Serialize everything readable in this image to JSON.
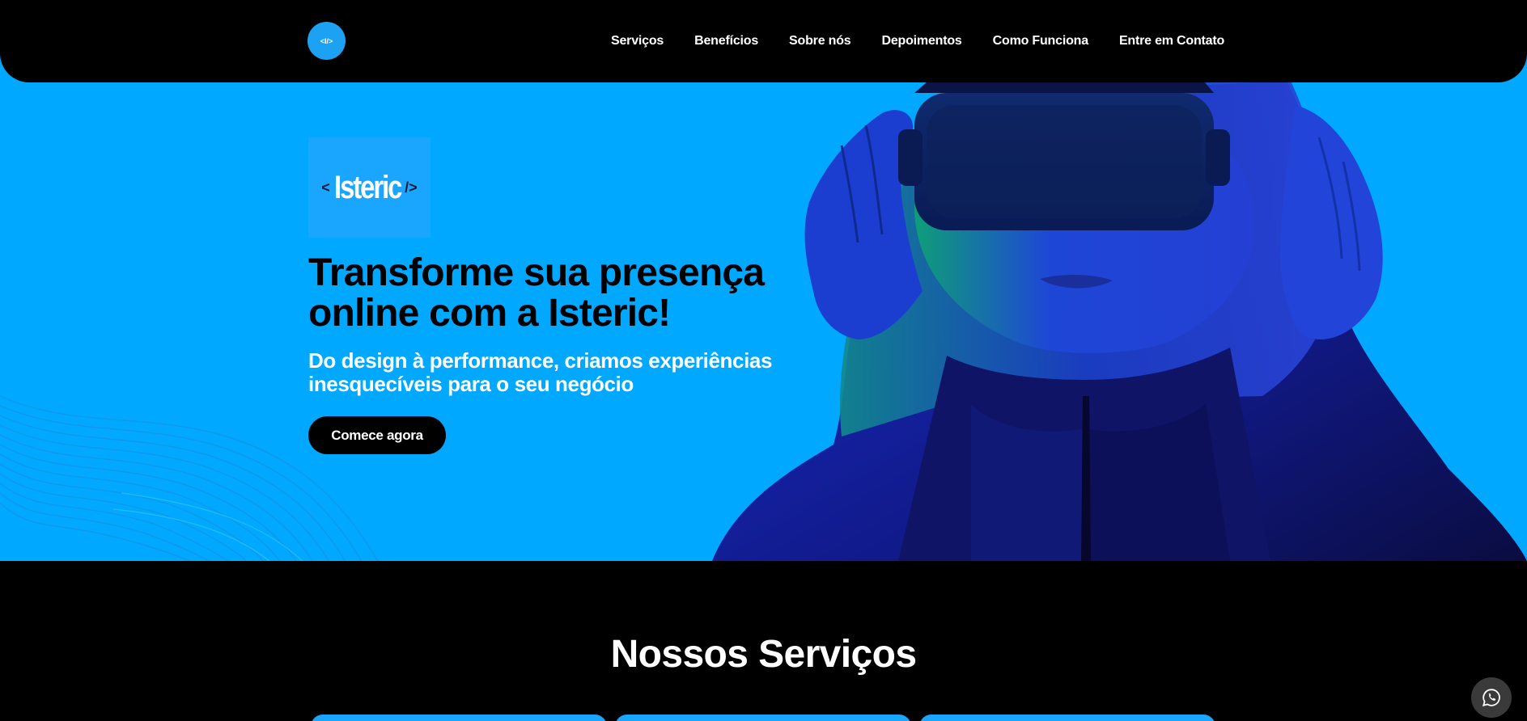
{
  "header": {
    "logo_mark": "<I/>",
    "nav": [
      {
        "label": "Serviços"
      },
      {
        "label": "Benefícios"
      },
      {
        "label": "Sobre nós"
      },
      {
        "label": "Depoimentos"
      },
      {
        "label": "Como Funciona"
      },
      {
        "label": "Entre em Contato"
      }
    ]
  },
  "hero": {
    "brand": {
      "open": "<",
      "name": "Isteric",
      "close": "/>"
    },
    "title": "Transforme sua presença online com a Isteric!",
    "subtitle": "Do design à performance, criamos experiências inesquecíveis para o seu negócio",
    "cta_label": "Comece agora",
    "image_alt": "Mulher usando óculos de realidade virtual"
  },
  "services": {
    "title": "Nossos Serviços",
    "cards": [
      {},
      {},
      {}
    ]
  },
  "floating": {
    "whatsapp_icon": "whatsapp-icon"
  },
  "colors": {
    "accent": "#00a8ff",
    "dark": "#000000",
    "card": "#1aa5ff",
    "float_button": "#3a3a3a"
  }
}
